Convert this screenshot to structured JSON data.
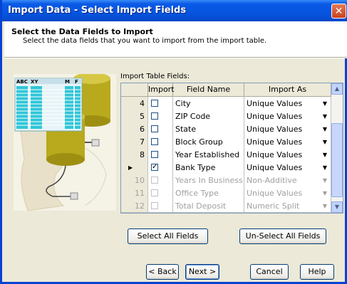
{
  "window": {
    "title": "Import Data - Select Import Fields"
  },
  "header": {
    "title": "Select the Data Fields to Import",
    "subtitle": "Select the data fields that you want to import from the import table."
  },
  "illustration": {
    "label_abc": "ABC",
    "label_xy": "XY",
    "label_m": "M",
    "label_f": "F"
  },
  "grid": {
    "label": "Import Table Fields:",
    "columns": [
      "Import",
      "Field Name",
      "Import As"
    ],
    "rows": [
      {
        "num": "4",
        "checked": false,
        "enabled": true,
        "selected": false,
        "field": "City",
        "import_as": "Unique Values"
      },
      {
        "num": "5",
        "checked": false,
        "enabled": true,
        "selected": false,
        "field": "ZIP Code",
        "import_as": "Unique Values"
      },
      {
        "num": "6",
        "checked": false,
        "enabled": true,
        "selected": false,
        "field": "State",
        "import_as": "Unique Values"
      },
      {
        "num": "7",
        "checked": false,
        "enabled": true,
        "selected": false,
        "field": "Block Group",
        "import_as": "Unique Values"
      },
      {
        "num": "8",
        "checked": false,
        "enabled": true,
        "selected": false,
        "field": "Year Established",
        "import_as": "Unique Values"
      },
      {
        "num": "",
        "checked": true,
        "enabled": true,
        "selected": true,
        "field": "Bank Type",
        "import_as": "Unique Values"
      },
      {
        "num": "10",
        "checked": false,
        "enabled": false,
        "selected": false,
        "field": "Years In Business",
        "import_as": "Non-Additive"
      },
      {
        "num": "11",
        "checked": false,
        "enabled": false,
        "selected": false,
        "field": "Office Type",
        "import_as": "Unique Values"
      },
      {
        "num": "12",
        "checked": false,
        "enabled": false,
        "selected": false,
        "field": "Total Deposit",
        "import_as": "Numeric Split"
      }
    ]
  },
  "buttons": {
    "select_all": "Select All Fields",
    "unselect_all": "Un-Select All Fields",
    "back": "< Back",
    "next": "Next >",
    "cancel": "Cancel",
    "help": "Help"
  },
  "colors": {
    "title_bar": "#0a5ae6",
    "close": "#c8411d",
    "dialog_bg": "#ece9d8"
  }
}
